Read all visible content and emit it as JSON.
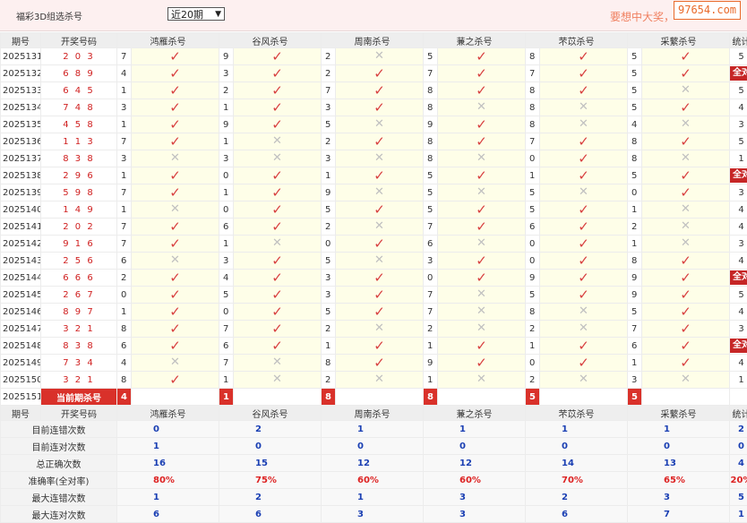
{
  "header": {
    "title": "福彩3D组选杀号",
    "period_select": "近20期",
    "slogan": "要想中大奖，",
    "logo": "97654.com"
  },
  "columns": {
    "period": "期号",
    "draw": "开奖号码",
    "methods": [
      "鸿雁杀号",
      "谷风杀号",
      "周南杀号",
      "蒹之杀号",
      "芣苡杀号",
      "采蘩杀号"
    ],
    "stats": "统计"
  },
  "rows": [
    {
      "period": "2025131",
      "draw": "2 0 3",
      "kills": [
        [
          "7",
          "ok"
        ],
        [
          "9",
          "ok"
        ],
        [
          "2",
          "x"
        ],
        [
          "5",
          "ok"
        ],
        [
          "8",
          "ok"
        ],
        [
          "5",
          "ok"
        ]
      ],
      "stat": "5"
    },
    {
      "period": "2025132",
      "draw": "6 8 9",
      "kills": [
        [
          "4",
          "ok"
        ],
        [
          "3",
          "ok"
        ],
        [
          "2",
          "ok"
        ],
        [
          "7",
          "ok"
        ],
        [
          "7",
          "ok"
        ],
        [
          "5",
          "ok"
        ]
      ],
      "stat": "全对"
    },
    {
      "period": "2025133",
      "draw": "6 4 5",
      "kills": [
        [
          "1",
          "ok"
        ],
        [
          "2",
          "ok"
        ],
        [
          "7",
          "ok"
        ],
        [
          "8",
          "ok"
        ],
        [
          "8",
          "ok"
        ],
        [
          "5",
          "x"
        ]
      ],
      "stat": "5"
    },
    {
      "period": "2025134",
      "draw": "7 4 8",
      "kills": [
        [
          "3",
          "ok"
        ],
        [
          "1",
          "ok"
        ],
        [
          "3",
          "ok"
        ],
        [
          "8",
          "x"
        ],
        [
          "8",
          "x"
        ],
        [
          "5",
          "ok"
        ]
      ],
      "stat": "4"
    },
    {
      "period": "2025135",
      "draw": "4 5 8",
      "kills": [
        [
          "1",
          "ok"
        ],
        [
          "9",
          "ok"
        ],
        [
          "5",
          "x"
        ],
        [
          "9",
          "ok"
        ],
        [
          "8",
          "x"
        ],
        [
          "4",
          "x"
        ]
      ],
      "stat": "3"
    },
    {
      "period": "2025136",
      "draw": "1 1 3",
      "kills": [
        [
          "7",
          "ok"
        ],
        [
          "1",
          "x"
        ],
        [
          "2",
          "ok"
        ],
        [
          "8",
          "ok"
        ],
        [
          "7",
          "ok"
        ],
        [
          "8",
          "ok"
        ]
      ],
      "stat": "5"
    },
    {
      "period": "2025137",
      "draw": "8 3 8",
      "kills": [
        [
          "3",
          "x"
        ],
        [
          "3",
          "x"
        ],
        [
          "3",
          "x"
        ],
        [
          "8",
          "x"
        ],
        [
          "0",
          "ok"
        ],
        [
          "8",
          "x"
        ]
      ],
      "stat": "1"
    },
    {
      "period": "2025138",
      "draw": "2 9 6",
      "kills": [
        [
          "1",
          "ok"
        ],
        [
          "0",
          "ok"
        ],
        [
          "1",
          "ok"
        ],
        [
          "5",
          "ok"
        ],
        [
          "1",
          "ok"
        ],
        [
          "5",
          "ok"
        ]
      ],
      "stat": "全对"
    },
    {
      "period": "2025139",
      "draw": "5 9 8",
      "kills": [
        [
          "7",
          "ok"
        ],
        [
          "1",
          "ok"
        ],
        [
          "9",
          "x"
        ],
        [
          "5",
          "x"
        ],
        [
          "5",
          "x"
        ],
        [
          "0",
          "ok"
        ]
      ],
      "stat": "3"
    },
    {
      "period": "2025140",
      "draw": "1 4 9",
      "kills": [
        [
          "1",
          "x"
        ],
        [
          "0",
          "ok"
        ],
        [
          "5",
          "ok"
        ],
        [
          "5",
          "ok"
        ],
        [
          "5",
          "ok"
        ],
        [
          "1",
          "x"
        ]
      ],
      "stat": "4"
    },
    {
      "period": "2025141",
      "draw": "2 0 2",
      "kills": [
        [
          "7",
          "ok"
        ],
        [
          "6",
          "ok"
        ],
        [
          "2",
          "x"
        ],
        [
          "7",
          "ok"
        ],
        [
          "6",
          "ok"
        ],
        [
          "2",
          "x"
        ]
      ],
      "stat": "4"
    },
    {
      "period": "2025142",
      "draw": "9 1 6",
      "kills": [
        [
          "7",
          "ok"
        ],
        [
          "1",
          "x"
        ],
        [
          "0",
          "ok"
        ],
        [
          "6",
          "x"
        ],
        [
          "0",
          "ok"
        ],
        [
          "1",
          "x"
        ]
      ],
      "stat": "3"
    },
    {
      "period": "2025143",
      "draw": "2 5 6",
      "kills": [
        [
          "6",
          "x"
        ],
        [
          "3",
          "ok"
        ],
        [
          "5",
          "x"
        ],
        [
          "3",
          "ok"
        ],
        [
          "0",
          "ok"
        ],
        [
          "8",
          "ok"
        ]
      ],
      "stat": "4"
    },
    {
      "period": "2025144",
      "draw": "6 6 6",
      "kills": [
        [
          "2",
          "ok"
        ],
        [
          "4",
          "ok"
        ],
        [
          "3",
          "ok"
        ],
        [
          "0",
          "ok"
        ],
        [
          "9",
          "ok"
        ],
        [
          "9",
          "ok"
        ]
      ],
      "stat": "全对"
    },
    {
      "period": "2025145",
      "draw": "2 6 7",
      "kills": [
        [
          "0",
          "ok"
        ],
        [
          "5",
          "ok"
        ],
        [
          "3",
          "ok"
        ],
        [
          "7",
          "x"
        ],
        [
          "5",
          "ok"
        ],
        [
          "9",
          "ok"
        ]
      ],
      "stat": "5"
    },
    {
      "period": "2025146",
      "draw": "8 9 7",
      "kills": [
        [
          "1",
          "ok"
        ],
        [
          "0",
          "ok"
        ],
        [
          "5",
          "ok"
        ],
        [
          "7",
          "x"
        ],
        [
          "8",
          "x"
        ],
        [
          "5",
          "ok"
        ]
      ],
      "stat": "4"
    },
    {
      "period": "2025147",
      "draw": "3 2 1",
      "kills": [
        [
          "8",
          "ok"
        ],
        [
          "7",
          "ok"
        ],
        [
          "2",
          "x"
        ],
        [
          "2",
          "x"
        ],
        [
          "2",
          "x"
        ],
        [
          "7",
          "ok"
        ]
      ],
      "stat": "3"
    },
    {
      "period": "2025148",
      "draw": "8 3 8",
      "kills": [
        [
          "6",
          "ok"
        ],
        [
          "6",
          "ok"
        ],
        [
          "1",
          "ok"
        ],
        [
          "1",
          "ok"
        ],
        [
          "1",
          "ok"
        ],
        [
          "6",
          "ok"
        ]
      ],
      "stat": "全对"
    },
    {
      "period": "2025149",
      "draw": "7 3 4",
      "kills": [
        [
          "4",
          "x"
        ],
        [
          "7",
          "x"
        ],
        [
          "8",
          "ok"
        ],
        [
          "9",
          "ok"
        ],
        [
          "0",
          "ok"
        ],
        [
          "1",
          "ok"
        ]
      ],
      "stat": "4"
    },
    {
      "period": "2025150",
      "draw": "3 2 1",
      "kills": [
        [
          "8",
          "ok"
        ],
        [
          "1",
          "x"
        ],
        [
          "2",
          "x"
        ],
        [
          "1",
          "x"
        ],
        [
          "2",
          "x"
        ],
        [
          "3",
          "x"
        ]
      ],
      "stat": "1"
    }
  ],
  "current": {
    "period": "2025151",
    "label": "当前期杀号",
    "kills": [
      "4",
      "1",
      "8",
      "8",
      "5",
      "5"
    ]
  },
  "stats_rows": [
    {
      "label": "目前连错次数",
      "values": [
        "0",
        "2",
        "1",
        "1",
        "1",
        "1"
      ],
      "total": "2",
      "red": false
    },
    {
      "label": "目前连对次数",
      "values": [
        "1",
        "0",
        "0",
        "0",
        "0",
        "0"
      ],
      "total": "0",
      "red": false
    },
    {
      "label": "总正确次数",
      "values": [
        "16",
        "15",
        "12",
        "12",
        "14",
        "13"
      ],
      "total": "4",
      "red": false
    },
    {
      "label": "准确率(全对率)",
      "values": [
        "80%",
        "75%",
        "60%",
        "60%",
        "70%",
        "65%"
      ],
      "total": "20%",
      "red": true
    },
    {
      "label": "最大连错次数",
      "values": [
        "1",
        "2",
        "1",
        "3",
        "2",
        "3"
      ],
      "total": "5",
      "red": false
    },
    {
      "label": "最大连对次数",
      "values": [
        "6",
        "6",
        "3",
        "3",
        "6",
        "7"
      ],
      "total": "1",
      "red": false
    }
  ],
  "icons": {
    "ok": "check-icon",
    "x": "cross-icon"
  },
  "colors": {
    "accent_red": "#d9312a",
    "check": "#d84040",
    "cross": "#c0c0c0",
    "stat_blue": "#1a3fb3"
  }
}
